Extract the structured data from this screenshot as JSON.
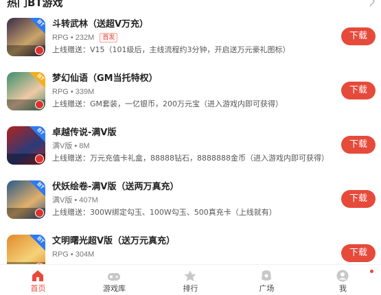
{
  "section": {
    "title": "热门BT游戏",
    "more_icon": "chevron-right-icon"
  },
  "games": [
    {
      "name": "斗转武林（送超V万充）",
      "meta": "RPG • 232M",
      "tag": "首发",
      "gift": "上线赠送：V15（101级后，主线流程约3分钟，开启送万元豪礼图标）",
      "button": "下载",
      "badge": "BT",
      "icon_colors": [
        "#3a2a4a",
        "#c9a56a"
      ]
    },
    {
      "name": "梦幻仙语（GM当托特权）",
      "meta": "RPG • 339M",
      "tag": "",
      "gift": "上线赠送：GM套装，一亿银币，200万元宝（进入游戏内即可获得）",
      "button": "下载",
      "badge": "BT",
      "icon_colors": [
        "#3b8f6a",
        "#f0c9a6"
      ]
    },
    {
      "name": "卓越传说-满V版",
      "meta": "满V版 • 8M",
      "tag": "",
      "gift": "上线赠送：万元充值卡礼盒，88888钻石，8888888金币（进入游戏内即可获得）",
      "button": "下载",
      "badge": "BT",
      "icon_colors": [
        "#b0241d",
        "#2a3b7a"
      ]
    },
    {
      "name": "伏妖绘卷-满V版（送两万真充）",
      "meta": "满V版 • 407M",
      "tag": "",
      "gift": "上线赠送：300W绑定勾玉、100W勾玉、500真充卡（上线就有）",
      "button": "下载",
      "badge": "BT",
      "icon_colors": [
        "#2a5a8a",
        "#e3b06a"
      ]
    },
    {
      "name": "文明曙光超V版（送万元真充）",
      "meta": "RPG • 304M",
      "tag": "",
      "gift": "",
      "button": "下载",
      "badge": "BT",
      "icon_colors": [
        "#e08a2a",
        "#f5d27a"
      ]
    }
  ],
  "tabbar": {
    "tabs": [
      {
        "label": "首页",
        "icon": "home-icon",
        "active": true
      },
      {
        "label": "游戏库",
        "icon": "gamepad-icon",
        "active": false
      },
      {
        "label": "排行",
        "icon": "ranking-icon",
        "active": false
      },
      {
        "label": "广场",
        "icon": "square-icon",
        "active": false
      },
      {
        "label": "我",
        "icon": "profile-icon",
        "active": false
      }
    ],
    "accent": "#e64a3b",
    "inactive_color": "#c8c8c8"
  }
}
